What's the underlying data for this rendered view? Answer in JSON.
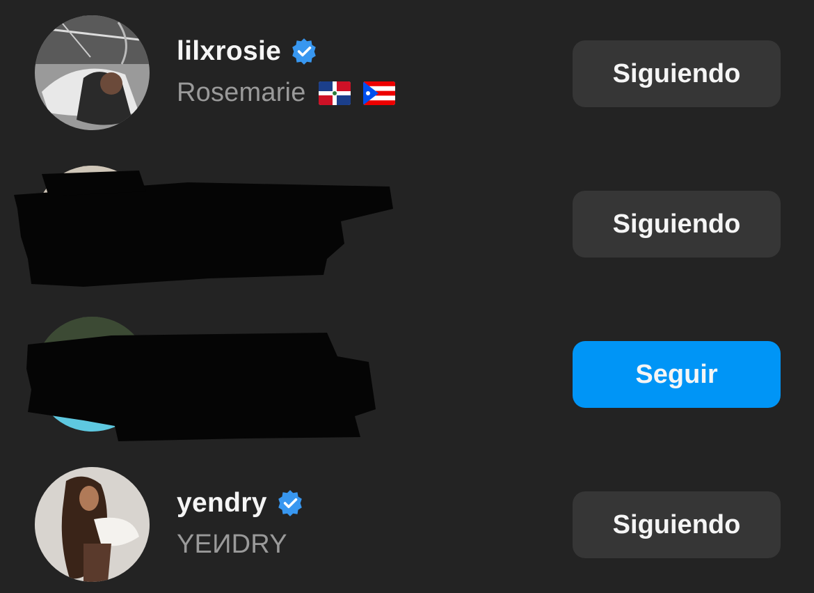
{
  "accounts": [
    {
      "username": "lilxrosie",
      "verified": true,
      "full_name": "Rosemarie",
      "flags": [
        "dominican-republic-flag",
        "puerto-rico-flag"
      ],
      "button_label": "Siguiendo",
      "button_state": "following"
    },
    {
      "redacted": true,
      "button_label": "Siguiendo",
      "button_state": "following"
    },
    {
      "redacted": true,
      "button_label": "Seguir",
      "button_state": "follow"
    },
    {
      "username": "yendry",
      "verified": true,
      "full_name": "YEИDRY",
      "button_label": "Siguiendo",
      "button_state": "following"
    }
  ],
  "colors": {
    "background": "#232323",
    "following_button": "#363636",
    "follow_button": "#0095f6",
    "verified_badge": "#3897f0"
  }
}
